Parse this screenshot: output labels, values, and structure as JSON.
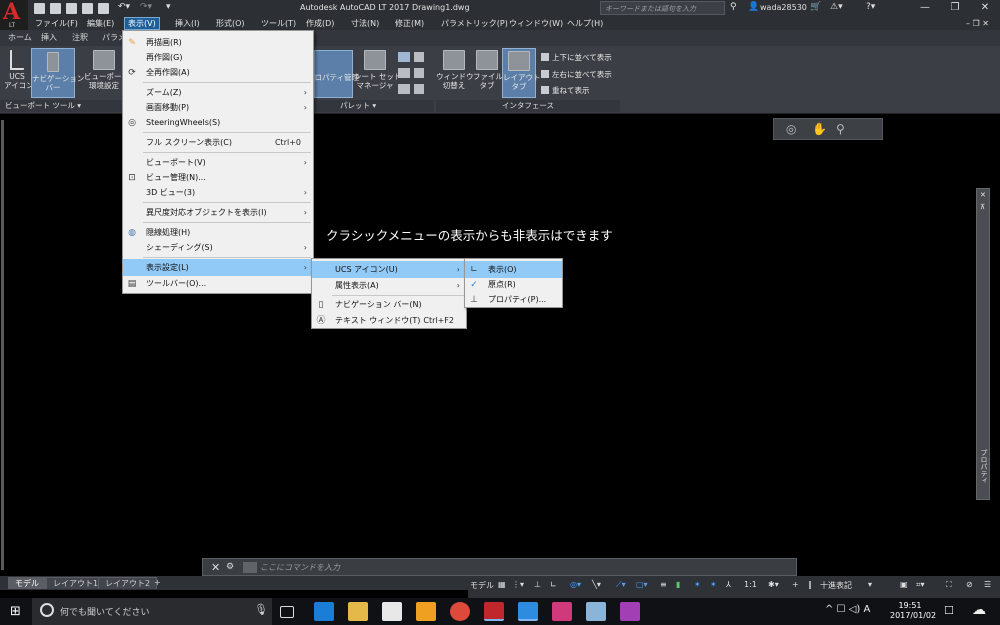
{
  "app": {
    "title": "Autodesk AutoCAD LT 2017    Drawing1.dwg",
    "logo_letter": "A",
    "logo_sub": "LT",
    "search_placeholder": "キーワードまたは語句を入力",
    "user": "wada28530"
  },
  "menubar": [
    "ファイル(F)",
    "編集(E)",
    "表示(V)",
    "挿入(I)",
    "形式(O)",
    "ツール(T)",
    "作成(D)",
    "寸法(N)",
    "修正(M)",
    "パラメトリック(P)",
    "ウィンドウ(W)",
    "ヘルプ(H)"
  ],
  "ribbon_tabs": [
    "ホーム",
    "挿入",
    "注釈",
    "パラメ"
  ],
  "ribbon": {
    "ucs_icon": "UCS\nアイコン",
    "nav_bar": "ナビゲーション\nバー",
    "viewport_cfg": "ビューポート\n環境設定",
    "panel_viewport_tools": "ビューポート ツール ▾",
    "properties_mgr": "プロパティ管理",
    "sheetset_mgr": "シート セット\nマネージャ",
    "panel_palettes": "パレット ▾",
    "switch_windows": "ウィンドウ\n切替え",
    "file_tabs": "ファイル\nタブ",
    "layout_tabs": "レイアウト\nタブ",
    "tile_horizontal": "上下に並べて表示",
    "tile_vertical": "左右に並べて表示",
    "cascade": "重ねて表示",
    "panel_interface": "インタフェース"
  },
  "viewport": {
    "overlay_text": "クラシックメニューの表示からも非表示はできます",
    "properties_palette_label": "プロパティ"
  },
  "view_menu": {
    "items": [
      {
        "label": "再描画(R)",
        "icon": "pencil-icon"
      },
      {
        "label": "再作図(G)"
      },
      {
        "label": "全再作図(A)",
        "icon": "regen-all-icon"
      },
      {
        "label": "ズーム(Z)",
        "submenu": true
      },
      {
        "label": "画面移動(P)",
        "submenu": true
      },
      {
        "label": "SteeringWheels(S)",
        "icon": "steering-wheel-icon"
      },
      {
        "label": "フル スクリーン表示(C)",
        "accel": "Ctrl+0"
      },
      {
        "label": "ビューポート(V)",
        "submenu": true
      },
      {
        "label": "ビュー管理(N)...",
        "icon": "view-manager-icon"
      },
      {
        "label": "3D ビュー(3)",
        "submenu": true
      },
      {
        "label": "異尺度対応オブジェクトを表示(I)",
        "submenu": true
      },
      {
        "label": "隠線処理(H)",
        "icon": "hide-icon"
      },
      {
        "label": "シェーディング(S)",
        "submenu": true
      },
      {
        "label": "表示設定(L)",
        "submenu": true,
        "highlighted": true
      },
      {
        "label": "ツールバー(O)...",
        "icon": "toolbar-icon"
      }
    ]
  },
  "display_submenu": {
    "items": [
      {
        "label": "UCS アイコン(U)",
        "submenu": true,
        "highlighted": true
      },
      {
        "label": "属性表示(A)",
        "submenu": true
      },
      {
        "label": "ナビゲーション バー(N)",
        "icon": "nav-bar-icon"
      },
      {
        "label": "テキスト ウィンドウ(T)",
        "accel": "Ctrl+F2",
        "icon": "text-window-icon"
      }
    ]
  },
  "ucs_submenu": {
    "items": [
      {
        "label": "表示(O)",
        "highlighted": true,
        "icon": "ucs-icon"
      },
      {
        "label": "原点(R)",
        "checked": true
      },
      {
        "label": "プロパティ(P)...",
        "icon": "properties-icon"
      }
    ]
  },
  "command_line": {
    "placeholder": "ここにコマンドを入力"
  },
  "layout_tabs": [
    "モデル",
    "レイアウト1",
    "レイアウト2",
    "+"
  ],
  "statusbar": {
    "model": "モデル",
    "scale": "1:1",
    "units": "十進表記"
  },
  "taskbar": {
    "search_text": "何でも聞いてください",
    "time": "19:51",
    "date": "2017/01/02",
    "ime": "A"
  },
  "colors": {
    "menu_highlight": "#91c9f7",
    "menu_bg": "#f0f0f0",
    "ribbon_bg": "#3b3f45",
    "titlebar_bg": "#2c2f34",
    "logo_red": "#d92a2a"
  }
}
